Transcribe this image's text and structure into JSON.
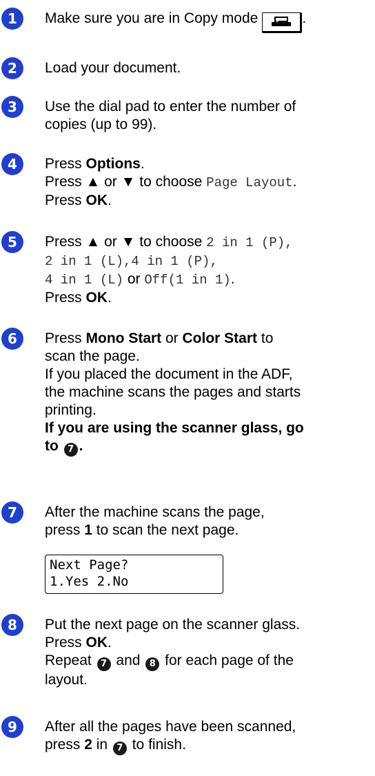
{
  "steps": [
    {
      "num": "1",
      "text": "Make sure you are in Copy mode",
      "icon": "copy-mode-key-icon",
      "after": "."
    },
    {
      "num": "2",
      "text": "Load your document."
    },
    {
      "num": "3",
      "line1": "Use the dial pad to enter the number of",
      "line2": "copies (up to 99)."
    },
    {
      "num": "4",
      "press": "Press ",
      "options": "Options",
      "period": ".",
      "choose_prefix": "Press ▲ or ▼ to choose ",
      "choose_value": "Page Layout",
      "choose_suffix": ".",
      "ok_press": "Press ",
      "ok": "OK",
      "ok_period": "."
    },
    {
      "num": "5",
      "choose_prefix": "Press ▲ or ▼ to choose ",
      "opt1": "2 in 1 (P),",
      "opt2": "2 in 1 (L),",
      "opt3": "4 in 1 (P),",
      "opt4": "4 in 1 (L)",
      "or": " or ",
      "opt5": "Off(1 in 1)",
      "opt_end": ".",
      "ok_press": "Press ",
      "ok": "OK",
      "ok_period": "."
    },
    {
      "num": "6",
      "press": "Press ",
      "mono": "Mono Start",
      "or": " or ",
      "color": "Color Start",
      "to": " to",
      "line2": "scan the page.",
      "line3": "If you placed the document in the ADF,",
      "line4": "the machine scans the pages and starts",
      "line5": "printing.",
      "bold1": "If you are using the scanner glass, go",
      "bold2": "to ",
      "ref": "7",
      "bold_end": "."
    },
    {
      "num": "7",
      "line1": "After the machine scans the page,",
      "press": "press ",
      "key": "1",
      "rest": " to scan the next page.",
      "lcd_line1": "Next Page?",
      "lcd_line2": "1.Yes 2.No"
    },
    {
      "num": "8",
      "line1": "Put the next page on the scanner glass.",
      "ok_press": "Press ",
      "ok": "OK",
      "ok_period": ".",
      "repeat": "Repeat ",
      "ref1": "7",
      "and": " and ",
      "ref2": "8",
      "rest": " for each page of the",
      "line4": "layout."
    },
    {
      "num": "9",
      "line1": "After all the pages have been scanned,",
      "press": "press ",
      "key": "2",
      "in": " in ",
      "ref": "7",
      "rest": " to finish."
    }
  ]
}
